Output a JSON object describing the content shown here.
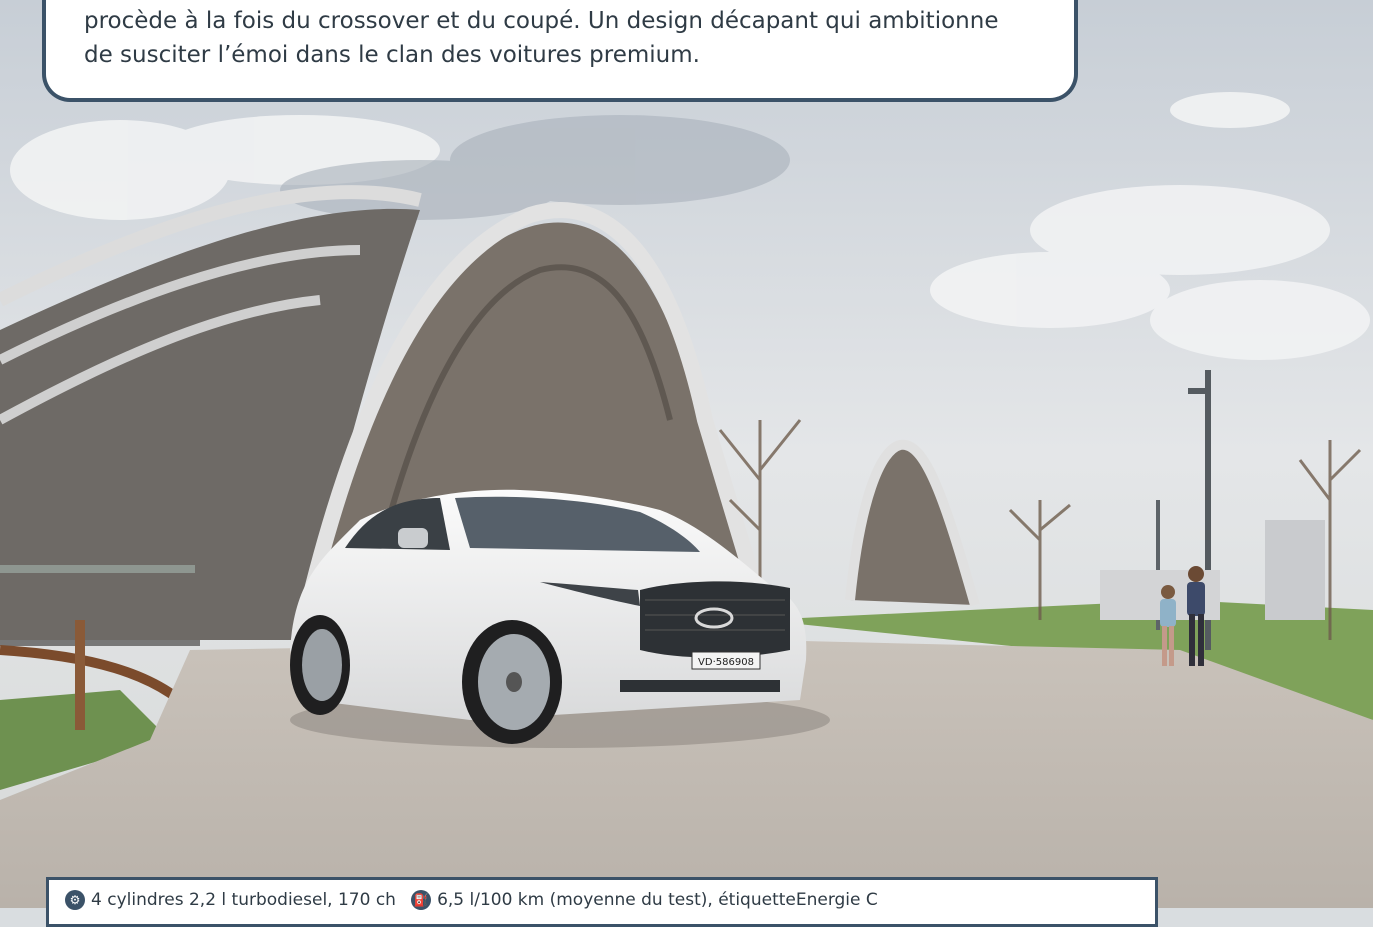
{
  "intro": {
    "line1": "procède à la fois du crossover et du coupé. Un design décapant qui ambitionne",
    "line2": "de susciter l’émoi dans le clan des voitures premium."
  },
  "photo": {
    "plate": "VD·586908"
  },
  "specs": {
    "engine_icon": "engine-icon",
    "engine": "4 cylindres 2,2 l turbodiesel, 170 ch",
    "fuel_icon": "fuel-pump-icon",
    "fuel": "6,5 l/100 km (moyenne du test), étiquetteEnergie C"
  }
}
